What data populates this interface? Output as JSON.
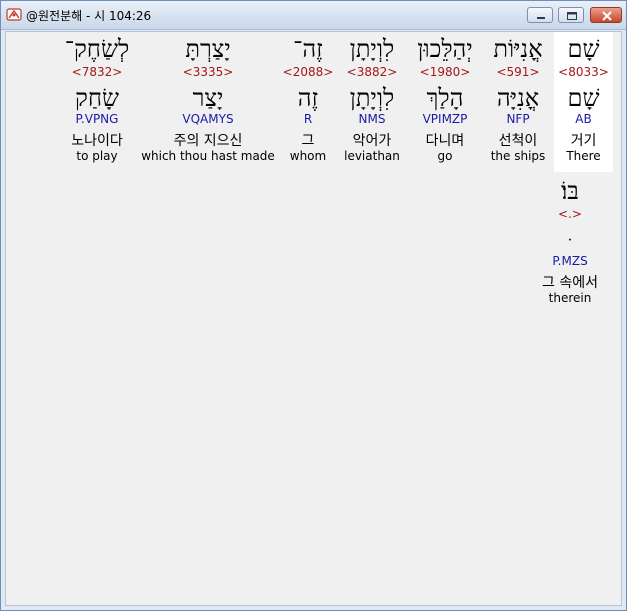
{
  "window": {
    "title": "@원전분해 - 시 104:26",
    "icon": "bible-app-icon"
  },
  "words": [
    {
      "heb": "שָׁם",
      "strong": "<8033>",
      "root": "שָׁם",
      "morph": "AB",
      "kor": "거기",
      "eng": "There",
      "selected": true
    },
    {
      "heb": "אֳנִיּוֹת",
      "strong": "<591>",
      "root": "אֳנִיָּה",
      "morph": "NFP",
      "kor": "선척이",
      "eng": "the ships",
      "selected": false
    },
    {
      "heb": "יְהַלֵּכוּן",
      "strong": "<1980>",
      "root": "הָלַךְ",
      "morph": "VPIMZP",
      "kor": "다니며",
      "eng": "go",
      "selected": false
    },
    {
      "heb": "לִוְיָתָן",
      "strong": "<3882>",
      "root": "לִוְיָתָן",
      "morph": "NMS",
      "kor": "악어가",
      "eng": "leviathan",
      "selected": false
    },
    {
      "heb": "זֶה־",
      "strong": "<2088>",
      "root": "זֶה",
      "morph": "R",
      "kor": "그",
      "eng": "whom",
      "selected": false
    },
    {
      "heb": "יָצַרְתָּ",
      "strong": "<3335>",
      "root": "יָצַר",
      "morph": "VQAMYS",
      "kor": "주의 지으신",
      "eng": "which thou hast made",
      "selected": false
    },
    {
      "heb": "לְשַׂחֶק־",
      "strong": "<7832>",
      "root": "שָׂחַק",
      "morph": "P.VPNG",
      "kor": "노나이다",
      "eng": "to play",
      "selected": false
    }
  ],
  "extra": {
    "heb": "בּוֹ׃",
    "strong": "<.>",
    "root": "ּ",
    "morph": "P.MZS",
    "kor": "그 속에서",
    "eng": "therein"
  }
}
